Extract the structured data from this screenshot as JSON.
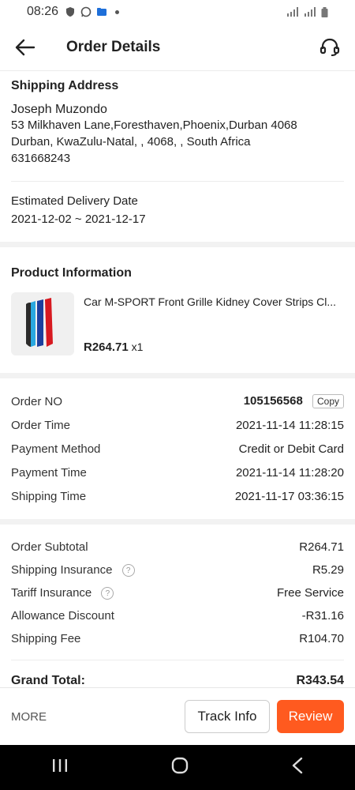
{
  "status_bar": {
    "time": "08:26"
  },
  "header": {
    "title": "Order Details"
  },
  "shipping_address": {
    "title": "Shipping Address",
    "name": "Joseph Muzondo",
    "line1": "53 Milkhaven Lane,Foresthaven,Phoenix,Durban 4068",
    "line2": "Durban, KwaZulu-Natal, , 4068, , South Africa",
    "phone": "631668243"
  },
  "delivery": {
    "label": "Estimated Delivery Date",
    "value": "2021-12-02 ~ 2021-12-17"
  },
  "product": {
    "title": "Product Information",
    "name": "Car M-SPORT Front Grille Kidney Cover Strips Cl...",
    "price": "R264.71",
    "qty": "x1"
  },
  "order_info": {
    "order_no_label": "Order NO",
    "order_no": "105156568",
    "copy_label": "Copy",
    "rows": [
      {
        "label": "Order Time",
        "value": "2021-11-14 11:28:15"
      },
      {
        "label": "Payment Method",
        "value": "Credit or Debit Card"
      },
      {
        "label": "Payment Time",
        "value": "2021-11-14 11:28:20"
      },
      {
        "label": "Shipping Time",
        "value": "2021-11-17 03:36:15"
      }
    ]
  },
  "fees": {
    "subtotal_label": "Order Subtotal",
    "subtotal": "R264.71",
    "insurance_label": "Shipping Insurance",
    "insurance": "R5.29",
    "tariff_label": "Tariff Insurance",
    "tariff": "Free Service",
    "allowance_label": "Allowance Discount",
    "allowance": "-R31.16",
    "shipping_fee_label": "Shipping Fee",
    "shipping_fee": "R104.70",
    "grand_label": "Grand Total:",
    "grand": "R343.54"
  },
  "bottom": {
    "more_label": "MORE",
    "track_label": "Track Info",
    "review_label": "Review"
  },
  "colors": {
    "accent": "#ff5a1f"
  },
  "icons": [
    "shield-icon",
    "whatsapp-icon",
    "folder-icon",
    "back-arrow-icon",
    "headset-icon",
    "help-icon",
    "recent-apps-icon",
    "home-icon",
    "nav-back-icon"
  ]
}
